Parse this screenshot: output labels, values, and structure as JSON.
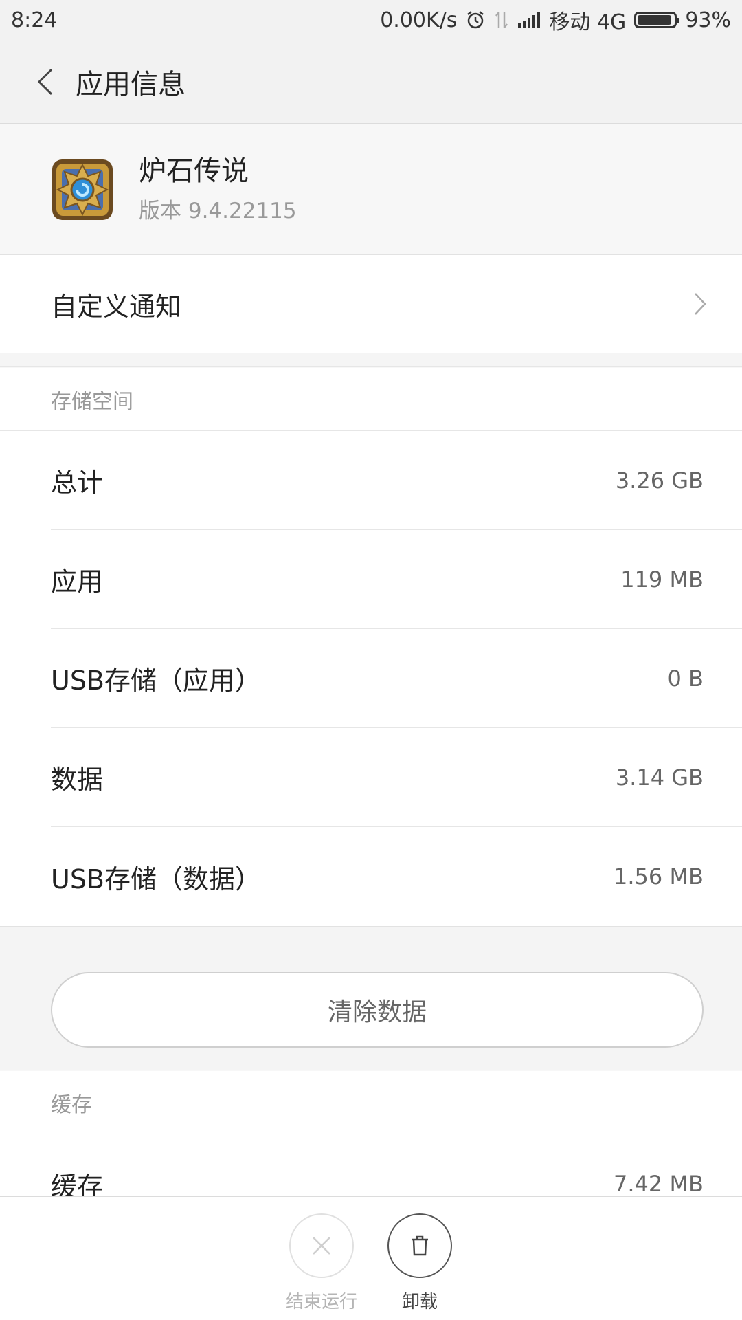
{
  "status_bar": {
    "time": "8:24",
    "net_speed": "0.00K/s",
    "carrier": "移动 4G",
    "battery": "93%",
    "battery_level": 0.93
  },
  "header": {
    "title": "应用信息"
  },
  "app": {
    "name": "炉石传说",
    "version": "版本 9.4.22115"
  },
  "notification_row": {
    "label": "自定义通知"
  },
  "storage": {
    "header": "存储空间",
    "rows": [
      {
        "label": "总计",
        "value": "3.26 GB"
      },
      {
        "label": "应用",
        "value": "119 MB"
      },
      {
        "label": "USB存储（应用）",
        "value": "0 B"
      },
      {
        "label": "数据",
        "value": "3.14 GB"
      },
      {
        "label": "USB存储（数据）",
        "value": "1.56 MB"
      }
    ],
    "clear_button": "清除数据"
  },
  "cache": {
    "header": "缓存",
    "rows": [
      {
        "label": "缓存",
        "value": "7.42 MB"
      }
    ]
  },
  "bottom_actions": {
    "stop_label": "结束运行",
    "uninstall_label": "卸载"
  },
  "colors": {
    "background": "#f7f7f7",
    "card": "#ffffff",
    "text_primary": "#222222",
    "text_secondary": "#999999",
    "divider": "#e6e6e6"
  }
}
